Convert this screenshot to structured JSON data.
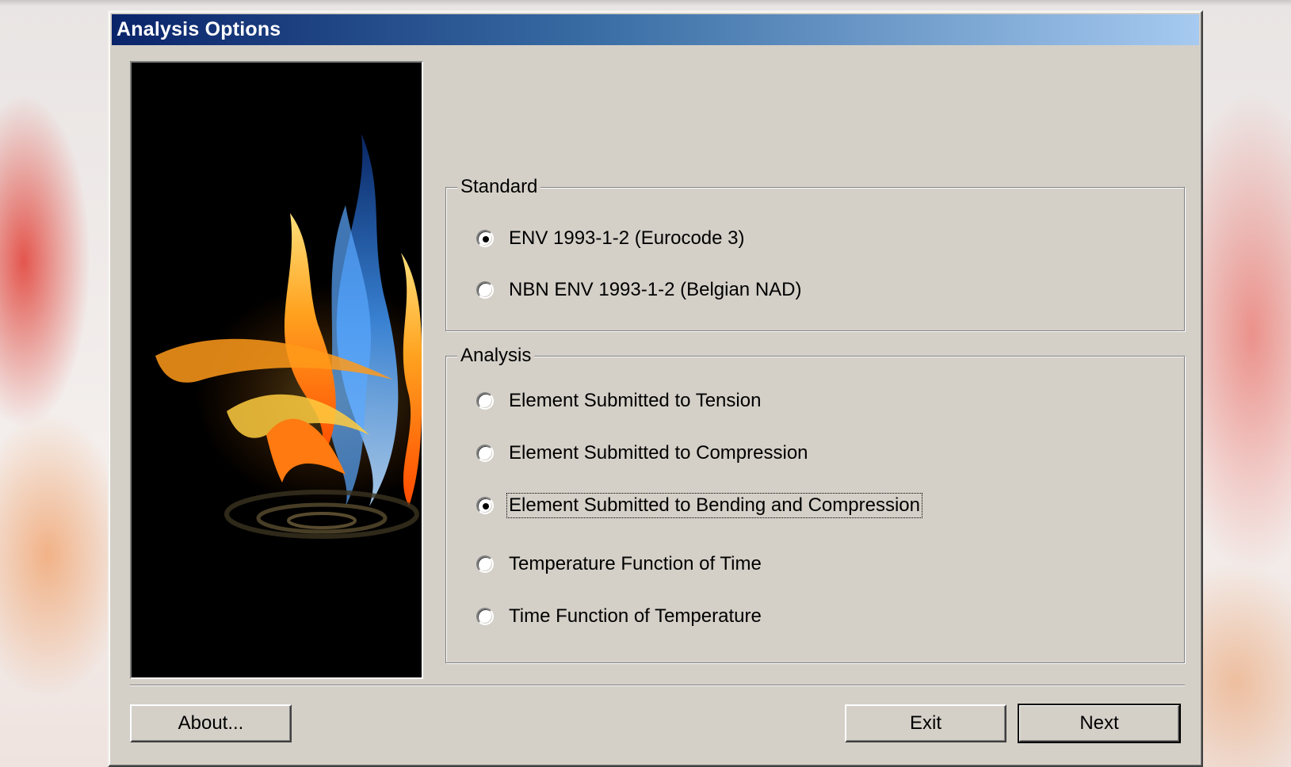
{
  "window": {
    "title": "Analysis Options"
  },
  "image": {
    "subject": "flame-and-water-artwork"
  },
  "standard": {
    "legend": "Standard",
    "options": [
      {
        "label": "ENV 1993-1-2 (Eurocode 3)",
        "checked": true
      },
      {
        "label": "NBN ENV 1993-1-2 (Belgian NAD)",
        "checked": false
      }
    ]
  },
  "analysis": {
    "legend": "Analysis",
    "options": [
      {
        "label": "Element Submitted to Tension",
        "checked": false
      },
      {
        "label": "Element Submitted to Compression",
        "checked": false
      },
      {
        "label": "Element Submitted to Bending and Compression",
        "checked": true,
        "focused": true
      },
      {
        "label": "Temperature Function of Time",
        "checked": false
      },
      {
        "label": "Time Function of Temperature",
        "checked": false
      }
    ]
  },
  "buttons": {
    "about": "About...",
    "exit": "Exit",
    "next": "Next"
  },
  "colors": {
    "dialog_face": "#d4d0c8",
    "title_gradient_start": "#0a246a",
    "title_gradient_end": "#a6caf0",
    "title_text": "#ffffff"
  }
}
